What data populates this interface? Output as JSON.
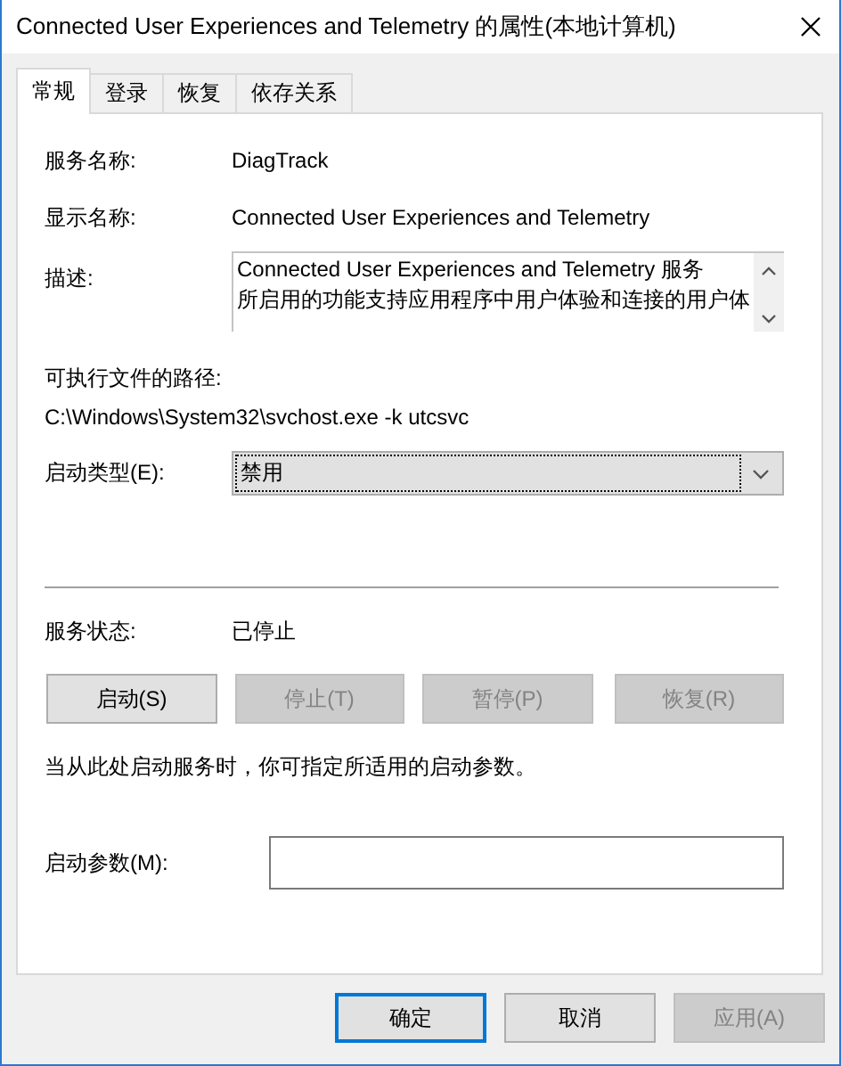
{
  "window": {
    "title": "Connected User Experiences and Telemetry 的属性(本地计算机)"
  },
  "tabs": [
    {
      "label": "常规",
      "selected": true
    },
    {
      "label": "登录",
      "selected": false
    },
    {
      "label": "恢复",
      "selected": false
    },
    {
      "label": "依存关系",
      "selected": false
    }
  ],
  "service_name": {
    "label": "服务名称:",
    "value": "DiagTrack"
  },
  "display_name": {
    "label": "显示名称:",
    "value": "Connected User Experiences and Telemetry"
  },
  "description": {
    "label": "描述:",
    "lines": [
      "Connected User Experiences and Telemetry 服务",
      "所启用的功能支持应用程序中用户体验和连接的用户体"
    ]
  },
  "executable_path": {
    "label": "可执行文件的路径:",
    "value": "C:\\Windows\\System32\\svchost.exe -k utcsvc"
  },
  "startup_type": {
    "label": "启动类型(E):",
    "value": "禁用"
  },
  "service_status": {
    "label": "服务状态:",
    "value": "已停止"
  },
  "service_buttons": [
    {
      "label": "启动(S)",
      "disabled": false
    },
    {
      "label": "停止(T)",
      "disabled": true
    },
    {
      "label": "暂停(P)",
      "disabled": true
    },
    {
      "label": "恢复(R)",
      "disabled": true
    }
  ],
  "hint": "当从此处启动服务时，你可指定所适用的启动参数。",
  "start_parameters": {
    "label": "启动参数(M):"
  },
  "dialog_buttons": [
    {
      "label": "确定",
      "default": true,
      "disabled": false
    },
    {
      "label": "取消",
      "default": false,
      "disabled": false
    },
    {
      "label": "应用(A)",
      "default": false,
      "disabled": true
    }
  ]
}
